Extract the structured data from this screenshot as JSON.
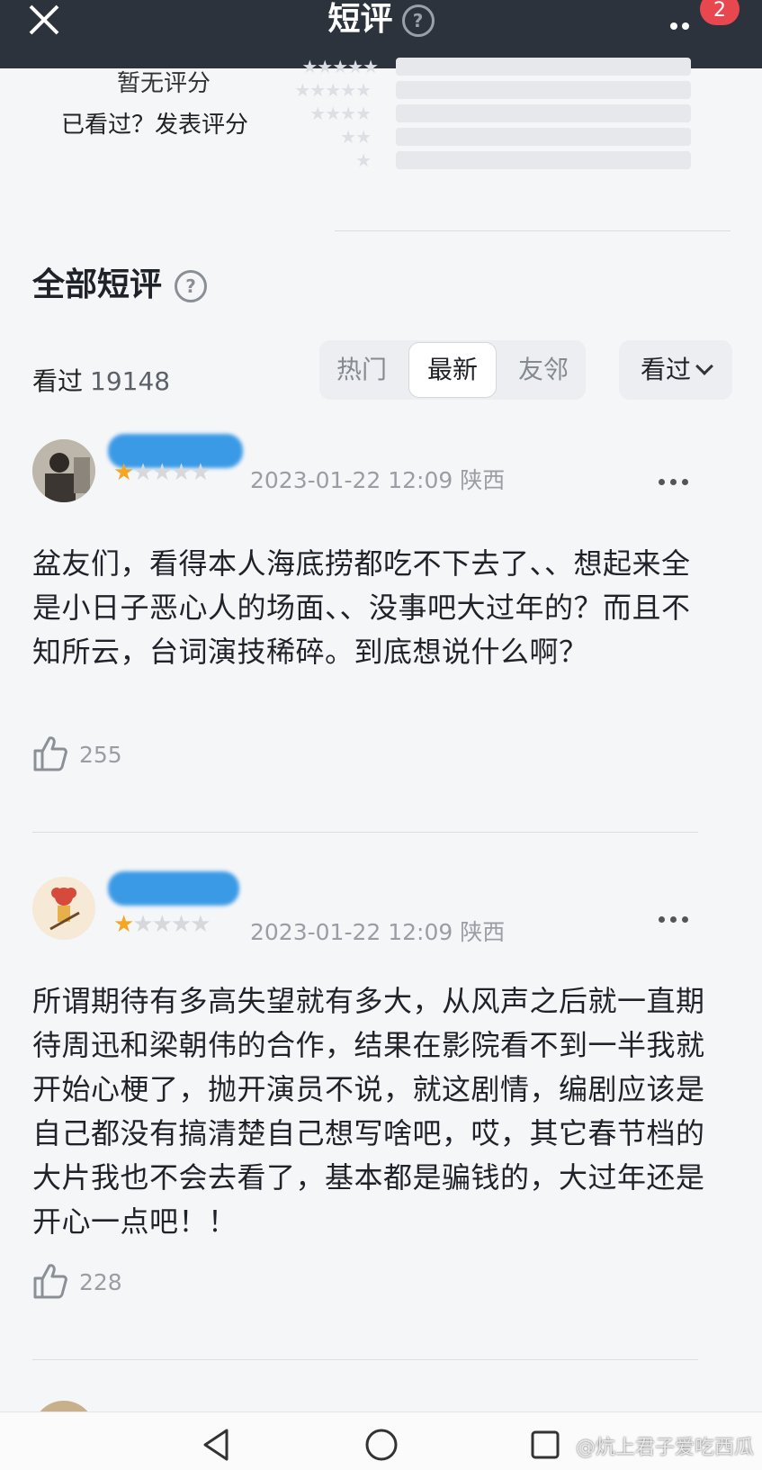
{
  "header": {
    "title": "短评",
    "help": "?",
    "badge_count": "2"
  },
  "rating": {
    "no_score": "暂无评分",
    "prompt": "已看过？发表评分"
  },
  "section": {
    "title": "全部短评",
    "help": "?"
  },
  "stats": {
    "watched_label": "看过",
    "watched_count": "19148"
  },
  "sort_tabs": [
    {
      "label": "热门",
      "active": false
    },
    {
      "label": "最新",
      "active": true
    },
    {
      "label": "友邻",
      "active": false
    }
  ],
  "filter": {
    "label": "看过"
  },
  "comments": [
    {
      "stars": "★",
      "stars_off": "★★★★",
      "rating": 1,
      "date": "2023-01-22 12:09",
      "location": "陕西",
      "text": "盆友们，看得本人海底捞都吃不下去了、、想起来全是小日子恶心人的场面、、没事吧大过年的？而且不知所云，台词演技稀碎。到底想说什么啊？",
      "likes": "255"
    },
    {
      "stars": "★",
      "stars_off": "★★★★",
      "rating": 1,
      "date": "2023-01-22 12:09",
      "location": "陕西",
      "text": "所谓期待有多高失望就有多大，从风声之后就一直期待周迅和梁朝伟的合作，结果在影院看不到一半我就开始心梗了，抛开演员不说，就这剧情，编剧应该是自己都没有搞清楚自己想写啥吧，哎，其它春节档的大片我也不会去看了，基本都是骗钱的，大过年还是开心一点吧！！",
      "likes": "228"
    }
  ],
  "watermark": "@炕上君子爱吃西瓜",
  "colors": {
    "accent_star": "#f5a623",
    "top_bar": "#2c333d",
    "badge": "#e8474f"
  }
}
